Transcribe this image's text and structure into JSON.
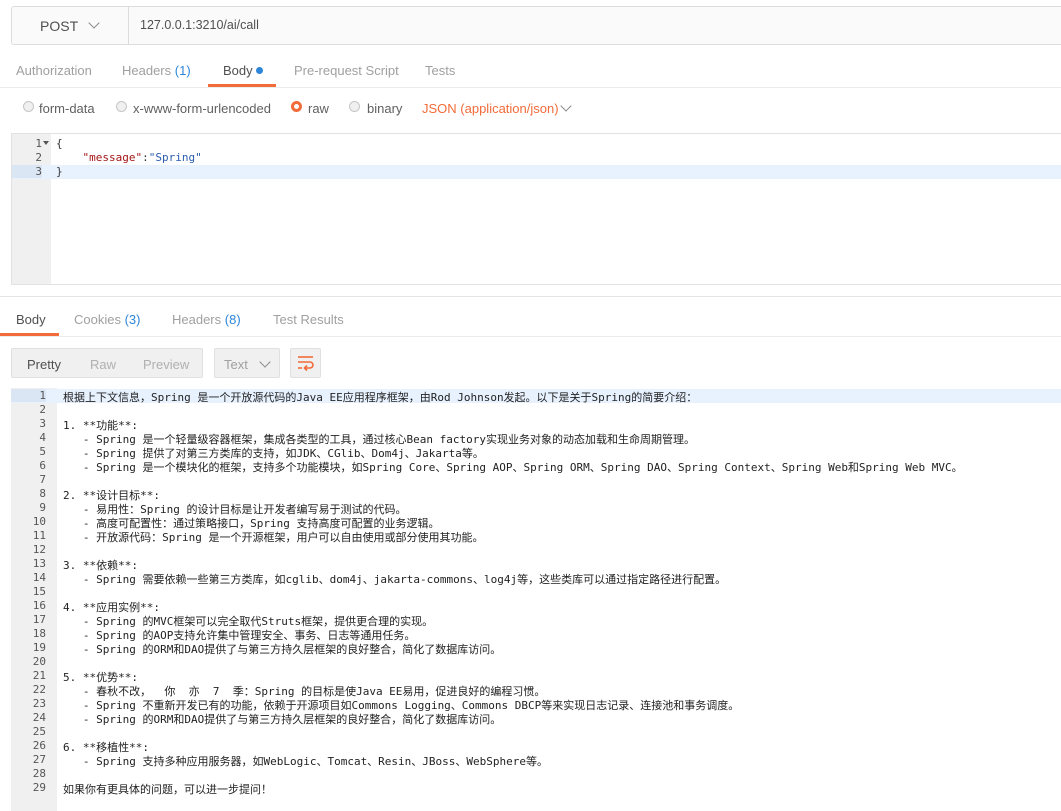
{
  "request": {
    "method": "POST",
    "url": "127.0.0.1:3210/ai/call"
  },
  "request_tabs": {
    "authorization": "Authorization",
    "headers": "Headers",
    "headers_count": "(1)",
    "body": "Body",
    "prerequest": "Pre-request Script",
    "tests": "Tests"
  },
  "body_types": {
    "form_data": "form-data",
    "urlencoded": "x-www-form-urlencoded",
    "raw": "raw",
    "binary": "binary",
    "content_type": "JSON (application/json)",
    "selected": "raw"
  },
  "request_body": {
    "line_numbers": [
      "1",
      "2",
      "3"
    ],
    "lines": [
      "{",
      "    \"message\":\"Spring\"",
      "}"
    ],
    "key": "\"message\"",
    "colon": ":",
    "value": "\"Spring\""
  },
  "response_tabs": {
    "body": "Body",
    "cookies": "Cookies",
    "cookies_count": "(3)",
    "headers": "Headers",
    "headers_count": "(8)",
    "test_results": "Test Results"
  },
  "response_view": {
    "pretty": "Pretty",
    "raw": "Raw",
    "preview": "Preview",
    "format": "Text",
    "active": "Pretty"
  },
  "icons": {
    "method_dropdown": "chevron-down-icon",
    "content_type_dropdown": "chevron-down-icon",
    "format_dropdown": "chevron-down-icon",
    "wrap": "wrap-lines-icon",
    "fold": "fold-arrow-icon"
  },
  "colors": {
    "accent": "#f26b3a",
    "link": "#2e86d8",
    "active_line": "#e8f2ff"
  },
  "response_body": {
    "lines": [
      {
        "n": "1",
        "text": "根据上下文信息，Spring 是一个开放源代码的Java EE应用程序框架，由Rod Johnson发起。以下是关于Spring的简要介绍："
      },
      {
        "n": "2",
        "text": ""
      },
      {
        "n": "3",
        "text": "1. **功能**:"
      },
      {
        "n": "4",
        "text": "   - Spring 是一个轻量级容器框架，集成各类型的工具，通过核心Bean factory实现业务对象的动态加载和生命周期管理。"
      },
      {
        "n": "5",
        "text": "   - Spring 提供了对第三方类库的支持，如JDK、CGlib、Dom4j、Jakarta等。"
      },
      {
        "n": "6",
        "text": "   - Spring 是一个模块化的框架，支持多个功能模块，如Spring Core、Spring AOP、Spring ORM、Spring DAO、Spring Context、Spring Web和Spring Web MVC。"
      },
      {
        "n": "7",
        "text": ""
      },
      {
        "n": "8",
        "text": "2. **设计目标**:"
      },
      {
        "n": "9",
        "text": "   - 易用性：Spring 的设计目标是让开发者编写易于测试的代码。"
      },
      {
        "n": "10",
        "text": "   - 高度可配置性：通过策略接口，Spring 支持高度可配置的业务逻辑。"
      },
      {
        "n": "11",
        "text": "   - 开放源代码：Spring 是一个开源框架，用户可以自由使用或部分使用其功能。"
      },
      {
        "n": "12",
        "text": ""
      },
      {
        "n": "13",
        "text": "3. **依赖**:"
      },
      {
        "n": "14",
        "text": "   - Spring 需要依赖一些第三方类库，如cglib、dom4j、jakarta-commons、log4j等，这些类库可以通过指定路径进行配置。"
      },
      {
        "n": "15",
        "text": ""
      },
      {
        "n": "16",
        "text": "4. **应用实例**:"
      },
      {
        "n": "17",
        "text": "   - Spring 的MVC框架可以完全取代Struts框架，提供更合理的实现。"
      },
      {
        "n": "18",
        "text": "   - Spring 的AOP支持允许集中管理安全、事务、日志等通用任务。"
      },
      {
        "n": "19",
        "text": "   - Spring 的ORM和DAO提供了与第三方持久层框架的良好整合，简化了数据库访问。"
      },
      {
        "n": "20",
        "text": ""
      },
      {
        "n": "21",
        "text": "5. **优势**:"
      },
      {
        "n": "22",
        "text": "   - 春秋不改，  你  亦  7  季：Spring 的目标是使Java EE易用，促进良好的编程习惯。"
      },
      {
        "n": "23",
        "text": "   - Spring 不重新开发已有的功能，依赖于开源项目如Commons Logging、Commons DBCP等来实现日志记录、连接池和事务调度。"
      },
      {
        "n": "24",
        "text": "   - Spring 的ORM和DAO提供了与第三方持久层框架的良好整合，简化了数据库访问。"
      },
      {
        "n": "25",
        "text": ""
      },
      {
        "n": "26",
        "text": "6. **移植性**:"
      },
      {
        "n": "27",
        "text": "   - Spring 支持多种应用服务器，如WebLogic、Tomcat、Resin、JBoss、WebSphere等。"
      },
      {
        "n": "28",
        "text": ""
      },
      {
        "n": "29",
        "text": "如果你有更具体的问题，可以进一步提问！"
      }
    ]
  }
}
